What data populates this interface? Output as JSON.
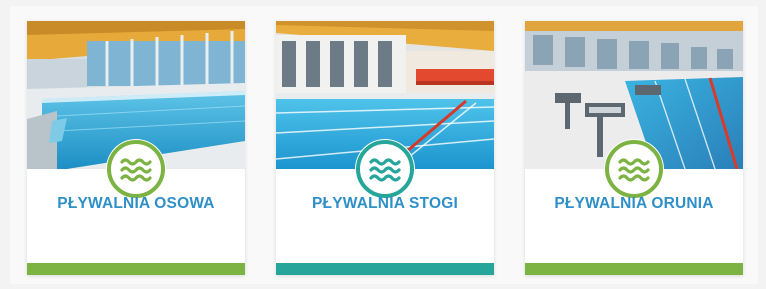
{
  "cards": [
    {
      "title": "PŁYWALNIA OSOWA",
      "accent": "#7cb342",
      "icon": "waves-icon"
    },
    {
      "title": "PŁYWALNIA STOGI",
      "accent": "#26a69a",
      "icon": "waves-icon"
    },
    {
      "title": "PŁYWALNIA ORUNIA",
      "accent": "#7cb342",
      "icon": "waves-icon"
    }
  ]
}
